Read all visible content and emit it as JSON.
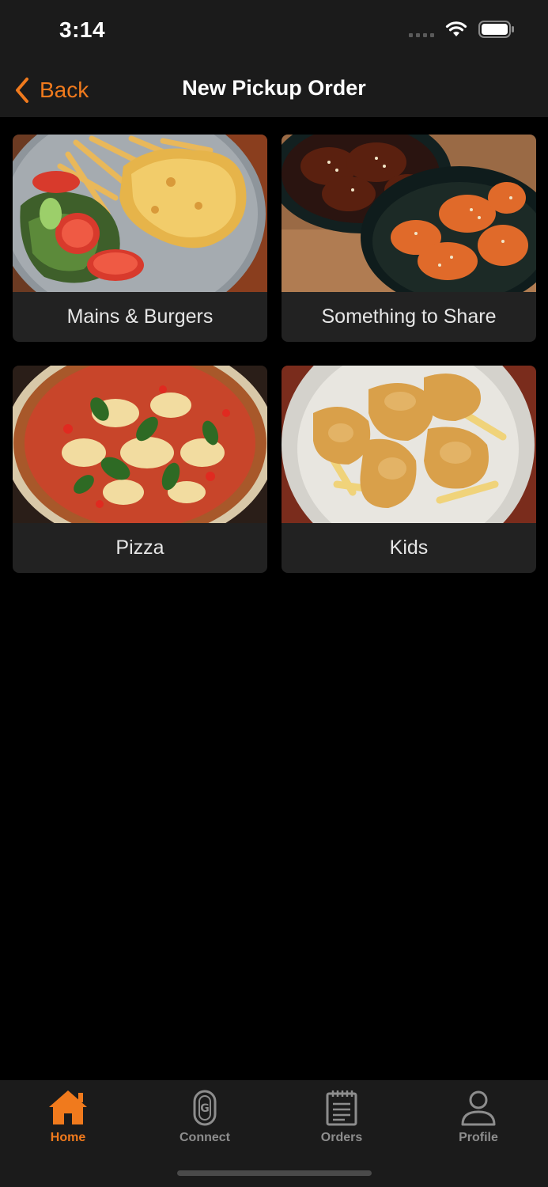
{
  "status": {
    "time": "3:14"
  },
  "nav": {
    "back_label": "Back",
    "title": "New Pickup Order"
  },
  "categories": [
    {
      "label": "Mains & Burgers",
      "image": "schnitzel-salad-fries-photo"
    },
    {
      "label": "Something to Share",
      "image": "chicken-wings-baskets-photo"
    },
    {
      "label": "Pizza",
      "image": "margherita-pizza-photo"
    },
    {
      "label": "Kids",
      "image": "chicken-nuggets-fries-photo"
    }
  ],
  "tabs": [
    {
      "label": "Home",
      "icon": "home-icon",
      "active": true
    },
    {
      "label": "Connect",
      "icon": "connect-icon",
      "active": false
    },
    {
      "label": "Orders",
      "icon": "orders-icon",
      "active": false
    },
    {
      "label": "Profile",
      "icon": "profile-icon",
      "active": false
    }
  ],
  "colors": {
    "accent": "#f07a1d",
    "bar": "#1b1b1b",
    "card": "#222222",
    "inactive": "#8d8d8d"
  }
}
